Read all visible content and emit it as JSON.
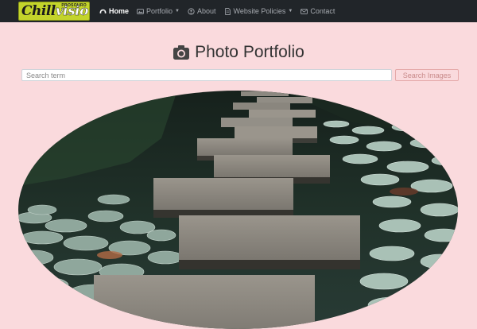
{
  "brand": {
    "logo_text_main": "Chill",
    "logo_text_accent": "visio",
    "logo_subtext": "PROSOURO"
  },
  "nav": {
    "items": [
      {
        "label": "Home",
        "icon": "tachometer-icon",
        "dropdown": false,
        "active": true
      },
      {
        "label": "Portfolio",
        "icon": "images-icon",
        "dropdown": true,
        "active": false
      },
      {
        "label": "About",
        "icon": "user-circle-icon",
        "dropdown": false,
        "active": false
      },
      {
        "label": "Website Policies",
        "icon": "file-icon",
        "dropdown": true,
        "active": false
      },
      {
        "label": "Contact",
        "icon": "envelope-icon",
        "dropdown": false,
        "active": false
      }
    ]
  },
  "page": {
    "title": "Photo Portfolio",
    "title_icon": "camera-icon"
  },
  "search": {
    "placeholder": "Search term",
    "value": "",
    "button_label": "Search Images"
  },
  "colors": {
    "navbar": "#212529",
    "page_background": "#fadadd",
    "brand": "#c3d42b",
    "search_button": "#e5a9a9"
  },
  "photo": {
    "subject": "stepping stones across a lily pad pond"
  }
}
